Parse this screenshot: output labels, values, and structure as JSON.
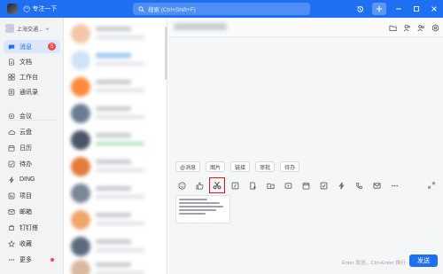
{
  "titlebar": {
    "status_emoji": "😶",
    "status_text": "专注一下",
    "search_placeholder": "搜索 (Ctrl+Shift+F)"
  },
  "org": {
    "name": "上海交通..."
  },
  "nav": {
    "items": [
      {
        "label": "消息",
        "icon": "chat-bubble-icon",
        "badge": "5",
        "active": true
      },
      {
        "label": "文档",
        "icon": "document-icon"
      },
      {
        "label": "工作台",
        "icon": "grid-icon"
      },
      {
        "label": "通讯录",
        "icon": "contacts-icon"
      },
      {
        "label": "会议",
        "icon": "video-icon"
      },
      {
        "label": "云盘",
        "icon": "cloud-icon"
      },
      {
        "label": "日历",
        "icon": "calendar-icon"
      },
      {
        "label": "待办",
        "icon": "checkbox-icon"
      },
      {
        "label": "DING",
        "icon": "bolt-icon"
      },
      {
        "label": "项目",
        "icon": "project-icon"
      },
      {
        "label": "邮箱",
        "icon": "mail-icon"
      },
      {
        "label": "钉钉搭",
        "icon": "build-icon"
      },
      {
        "label": "收藏",
        "icon": "star-icon"
      },
      {
        "label": "更多",
        "icon": "more-icon",
        "dot": true
      }
    ]
  },
  "quick_replies": [
    {
      "label": "@消息"
    },
    {
      "label": "图片"
    },
    {
      "label": "链接"
    },
    {
      "label": "审批"
    },
    {
      "label": "待办"
    }
  ],
  "composer": {
    "highlighted_tool": "scissors-icon",
    "hint": "Enter 发送，Ctrl+Enter 换行",
    "send_label": "发送"
  },
  "colors": {
    "brand": "#1e6ff1",
    "highlight_box": "#e1141b",
    "badge": "#f54a45"
  }
}
